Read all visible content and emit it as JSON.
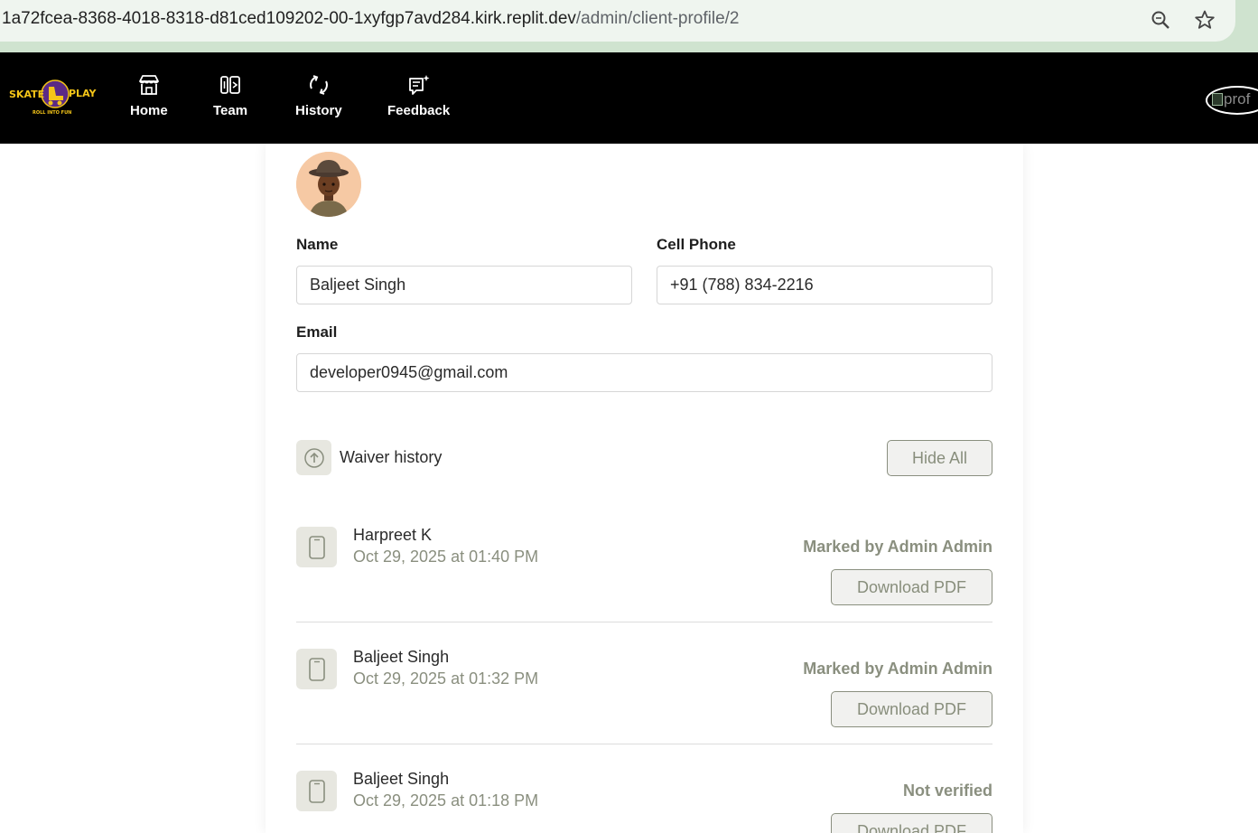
{
  "browser": {
    "url_host": "1a72fcea-8368-4018-8318-d81ced109202-00-1xyfgp7avd284.kirk.replit.dev",
    "url_path": "/admin/client-profile/2",
    "icons": [
      "zoom-icon",
      "bookmark-star-icon"
    ]
  },
  "nav": {
    "logo_left": "SKATE",
    "logo_right": "PLAY",
    "logo_tagline": "ROLL INTO FUN",
    "items": [
      {
        "label": "Home",
        "icon": "store-icon"
      },
      {
        "label": "Team",
        "icon": "team-icon"
      },
      {
        "label": "History",
        "icon": "refresh-icon"
      },
      {
        "label": "Feedback",
        "icon": "feedback-icon"
      }
    ],
    "profile_alt": "prof"
  },
  "profile": {
    "name_label": "Name",
    "name_value": "Baljeet Singh",
    "phone_label": "Cell Phone",
    "phone_value": "+91 (788) 834-2216",
    "email_label": "Email",
    "email_value": "developer0945@gmail.com"
  },
  "waiver": {
    "title": "Waiver history",
    "hide_all": "Hide All",
    "records": [
      {
        "name": "Harpreet K",
        "date": "Oct 29, 2025 at 01:40 PM",
        "status": "Marked by Admin Admin",
        "button": "Download PDF"
      },
      {
        "name": "Baljeet Singh",
        "date": "Oct 29, 2025 at 01:32 PM",
        "status": "Marked by Admin Admin",
        "button": "Download PDF"
      },
      {
        "name": "Baljeet Singh",
        "date": "Oct 29, 2025 at 01:18 PM",
        "status": "Not verified",
        "button": "Download PDF"
      }
    ]
  },
  "colors": {
    "nav_bg": "#000000",
    "accent_muted": "#8a8f7f",
    "logo_yellow": "#f5c518",
    "logo_purple": "#5b2a86"
  }
}
